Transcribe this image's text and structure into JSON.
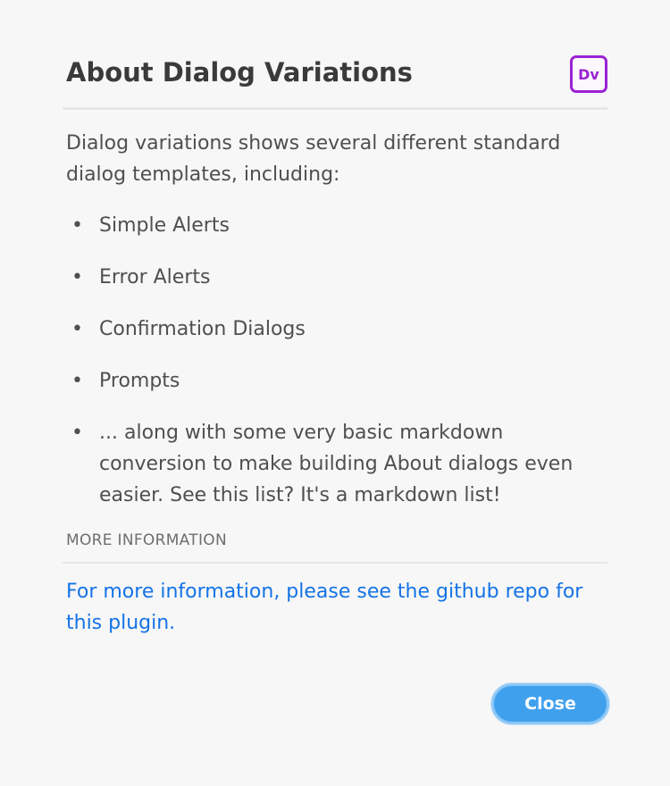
{
  "dialog": {
    "title": "About Dialog Variations",
    "app_badge": "Dv",
    "intro": "Dialog variations shows several different standard dialog templates, including:",
    "features": [
      "Simple Alerts",
      "Error Alerts",
      "Confirmation Dialogs",
      "Prompts",
      "... along with some very basic markdown conversion to make building About dialogs even easier. See this list? It's a markdown list!"
    ],
    "bullet": "•",
    "more_info_heading": "MORE INFORMATION",
    "more_info_link": "For more information, please see the github repo for this plugin.",
    "close_label": "Close"
  },
  "colors": {
    "background": "#f7f7f7",
    "badge": "#9b22d3",
    "link": "#1473e6",
    "button": "#3fa0ee"
  }
}
